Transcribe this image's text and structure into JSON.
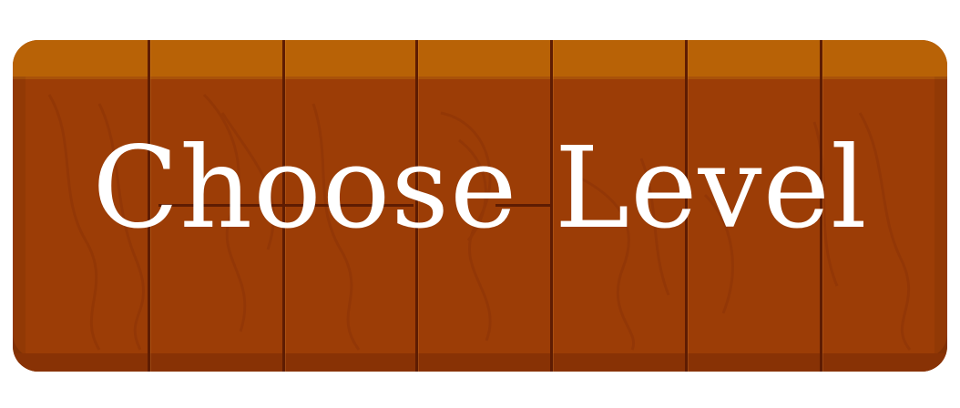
{
  "button": {
    "label": "Choose Level"
  },
  "colors": {
    "wood_base": "#9c3d06",
    "wood_top": "#b86206",
    "wood_bottom": "#883205",
    "seam": "#5e1c02",
    "text": "#ffffff"
  },
  "icons": [
    "wood-plank-texture"
  ]
}
